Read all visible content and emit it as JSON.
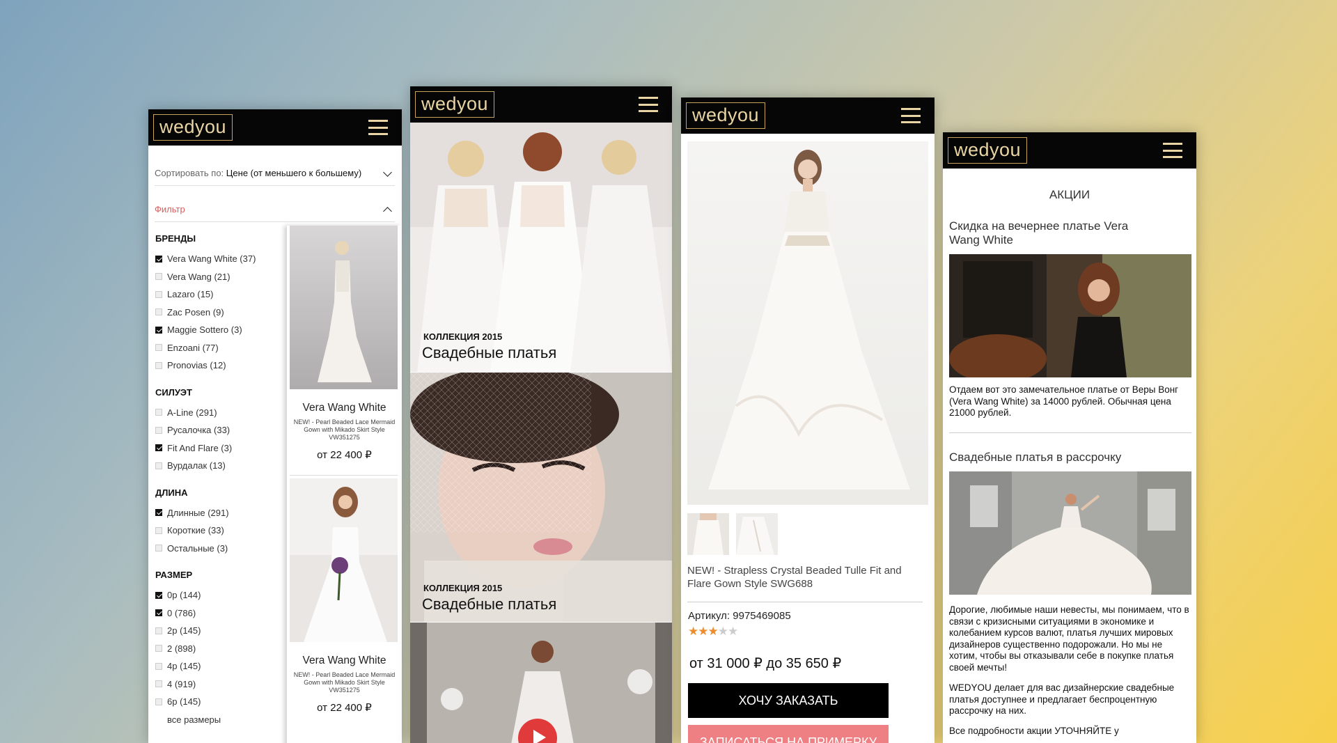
{
  "logo": "wedyou",
  "catalog": {
    "sort_label": "Сортировать по:",
    "sort_value": "Цене (от меньшего к большему)",
    "filter_label": "Фильтр",
    "groups": [
      {
        "title": "БРЕНДЫ",
        "items": [
          {
            "label": "Vera Wang White (37)",
            "checked": true
          },
          {
            "label": "Vera Wang (21)",
            "checked": false
          },
          {
            "label": "Lazaro (15)",
            "checked": false
          },
          {
            "label": "Zac Posen (9)",
            "checked": false
          },
          {
            "label": "Maggie Sottero (3)",
            "checked": true
          },
          {
            "label": "Enzoani (77)",
            "checked": false
          },
          {
            "label": "Pronovias (12)",
            "checked": false
          }
        ]
      },
      {
        "title": "СИЛУЭТ",
        "items": [
          {
            "label": "A-Line (291)",
            "checked": false
          },
          {
            "label": "Русалочка (33)",
            "checked": false
          },
          {
            "label": "Fit And Flare (3)",
            "checked": true
          },
          {
            "label": "Вурдалак (13)",
            "checked": false
          }
        ]
      },
      {
        "title": "ДЛИНА",
        "items": [
          {
            "label": "Длинные (291)",
            "checked": true
          },
          {
            "label": "Короткие (33)",
            "checked": false
          },
          {
            "label": "Остальные (3)",
            "checked": false
          }
        ]
      },
      {
        "title": "РАЗМЕР",
        "items": [
          {
            "label": "0р (144)",
            "checked": true
          },
          {
            "label": "0 (786)",
            "checked": true
          },
          {
            "label": "2р (145)",
            "checked": false
          },
          {
            "label": "2 (898)",
            "checked": false
          },
          {
            "label": "4р (145)",
            "checked": false
          },
          {
            "label": "4 (919)",
            "checked": false
          },
          {
            "label": "6р (145)",
            "checked": false
          }
        ]
      }
    ],
    "all_sizes": "все размеры",
    "products": [
      {
        "name": "Vera Wang White",
        "desc": "NEW! - Pearl Beaded Lace Mermaid Gown with Mikado Skirt Style VW351275",
        "price": "от 22 400 ₽"
      },
      {
        "name": "Vera Wang White",
        "desc": "NEW! - Pearl Beaded Lace Mermaid Gown with Mikado Skirt Style VW351275",
        "price": "от 22 400 ₽"
      }
    ]
  },
  "collections": {
    "banners": [
      {
        "small": "КОЛЛЕКЦИЯ 2015",
        "big": "Свадебные платья"
      },
      {
        "small": "КОЛЛЕКЦИЯ 2015",
        "big": "Свадебные платья"
      }
    ]
  },
  "product": {
    "title": "NEW! - Strapless Crystal Beaded Tulle Fit and Flare Gown Style SWG688",
    "article": "Артикул: 9975469085",
    "rating": 3,
    "rating_max": 5,
    "price": "от 31 000 ₽ до 35 650 ₽",
    "order_button": "ХОЧУ ЗАКАЗАТЬ",
    "fitting_button": "ЗАПИСАТЬСЯ НА ПРИМЕРКУ"
  },
  "promos": {
    "heading": "АКЦИИ",
    "items": [
      {
        "title": "Скидка на вечернее платье Vera Wang White",
        "text": "Отдаем вот это замечательное платье от Веры Вонг (Vera Wang White) за 14000 рублей. Обычная цена 21000 рублей."
      },
      {
        "title": "Свадебные платья в рассрочку",
        "text": "Дорогие, любимые наши невесты, мы понимаем, что в связи с кризисными ситуациями в экономике и колебанием курсов валют, платья лучших мировых дизайнеров существенно подорожали. Но мы не хотим, чтобы вы отказывали себе в покупке платья своей мечты!",
        "text2": "WEDYOU делает для вас дизайнерские свадебные платья доступнее и предлагает беспроцентную рассрочку на них.",
        "text3": "Все подробности акции УТОЧНЯЙТЕ у"
      }
    ]
  },
  "colors": {
    "header": "#060606",
    "logo": "#c9a55a",
    "filter": "#e05a5a",
    "star": "#ee8c2c",
    "fitting": "#ee7f83"
  }
}
